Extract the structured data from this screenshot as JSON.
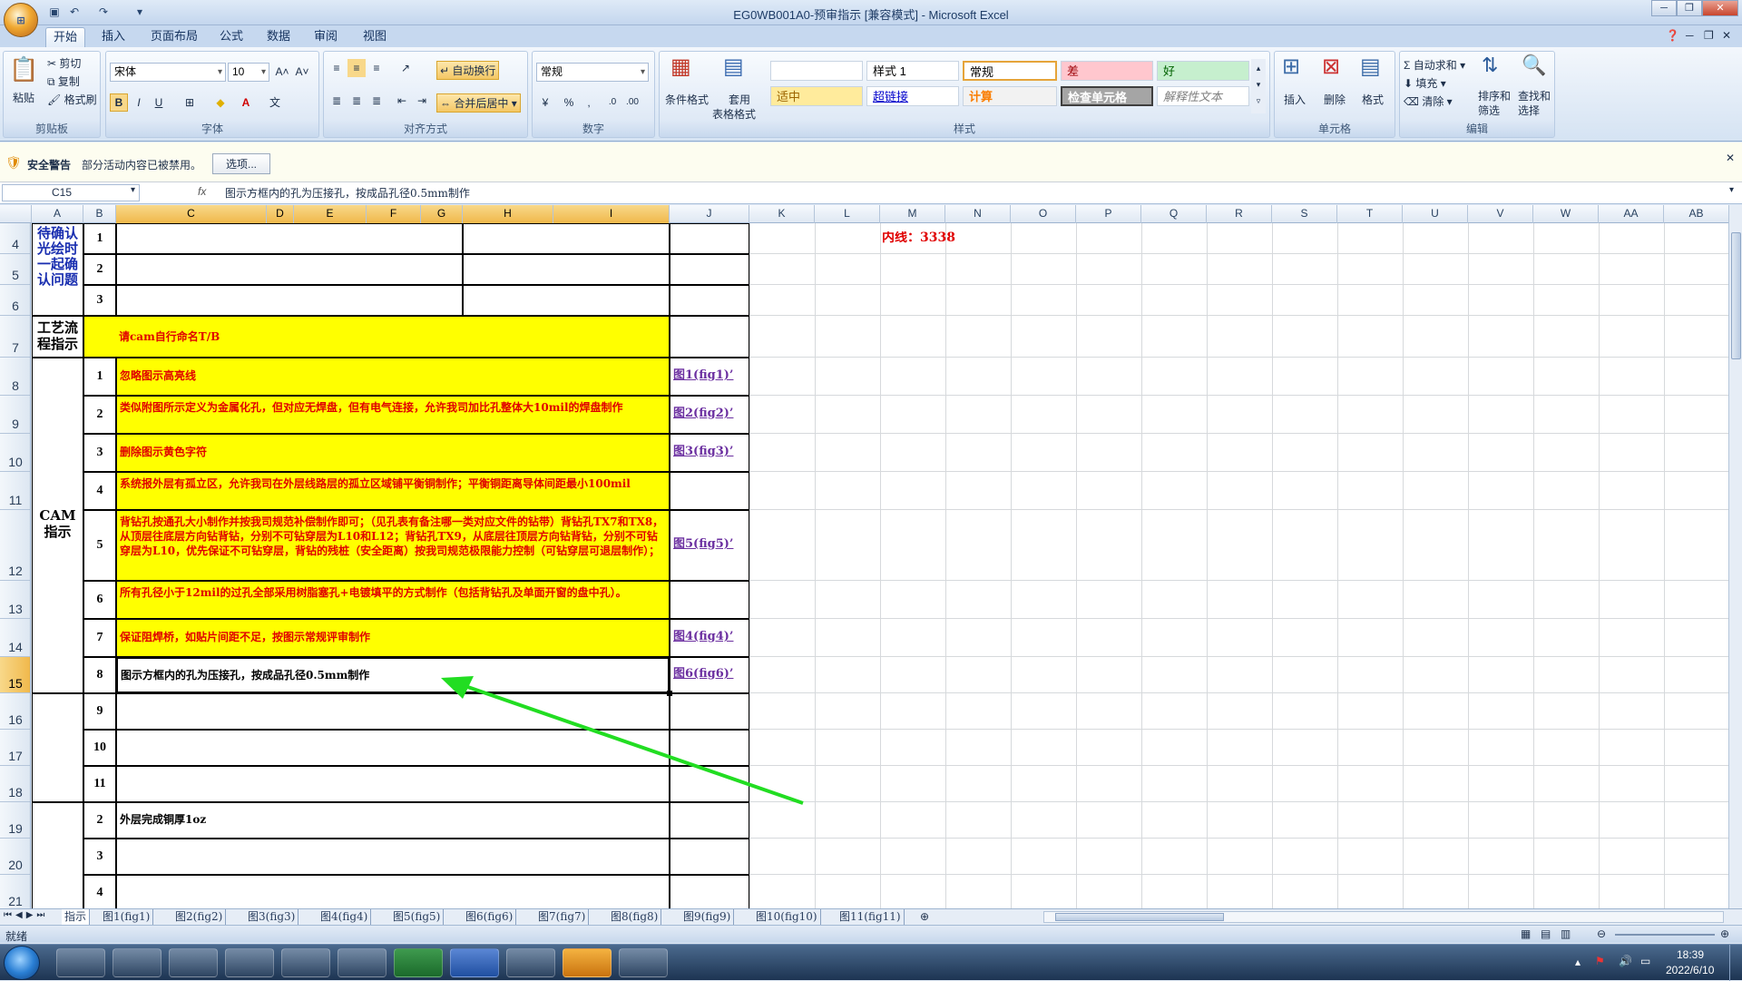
{
  "window": {
    "title": "EG0WB001A0-预审指示 [兼容模式] - Microsoft Excel"
  },
  "ribbon_tabs": [
    "开始",
    "插入",
    "页面布局",
    "公式",
    "数据",
    "审阅",
    "视图"
  ],
  "clipboard": {
    "paste": "粘贴",
    "cut": "剪切",
    "copy": "复制",
    "format_painter": "格式刷",
    "label": "剪贴板"
  },
  "font": {
    "name": "宋体",
    "size": "10",
    "label": "字体"
  },
  "alignment": {
    "wrap": "自动换行",
    "merge": "合并后居中",
    "label": "对齐方式"
  },
  "number": {
    "format": "常规",
    "label": "数字"
  },
  "styles": {
    "cond": "条件格式",
    "table": "套用",
    "table2": "表格格式",
    "label": "样式",
    "cells": [
      "",
      "样式 1",
      "常规",
      "差",
      "好",
      "适中",
      "超链接",
      "计算",
      "检查单元格",
      "解释性文本"
    ]
  },
  "cells_grp": {
    "insert": "插入",
    "delete": "删除",
    "format": "格式",
    "label": "单元格"
  },
  "edit_grp": {
    "autosum": "自动求和",
    "fill": "填充",
    "clear": "清除",
    "sort": "排序和",
    "sort2": "筛选",
    "find": "查找和",
    "find2": "选择",
    "label": "编辑"
  },
  "security": {
    "title": "安全警告",
    "msg": "部分活动内容已被禁用。",
    "options": "选项..."
  },
  "formula_bar": {
    "namebox": "C15",
    "fx": "fx",
    "content": "图示方框内的孔为压接孔，按成品孔径0.5mm制作"
  },
  "columns": [
    "A",
    "B",
    "C",
    "D",
    "E",
    "F",
    "G",
    "H",
    "I",
    "J",
    "K",
    "L",
    "M",
    "N",
    "O",
    "P",
    "Q",
    "R",
    "S",
    "T",
    "U",
    "V",
    "W",
    "AA",
    "AB"
  ],
  "rows": [
    "4",
    "5",
    "6",
    "7",
    "8",
    "9",
    "10",
    "11",
    "12",
    "13",
    "14",
    "15",
    "16",
    "17",
    "18",
    "19",
    "20",
    "21"
  ],
  "sheet": {
    "confirm_label": "待确认光绘时一起确认问题",
    "process_label": "工艺流程指示",
    "cam_label": "CAM指示",
    "process_text": "请cam自行命名T/B",
    "inner_layer": "内线：3338",
    "items": [
      {
        "n": "1",
        "text": "忽略图示高亮线",
        "link": "图1(fig1)’"
      },
      {
        "n": "2",
        "text": "类似附图所示定义为金属化孔，但对应无焊盘，但有电气连接，允许我司加比孔整体大10mil的焊盘制作",
        "link": "图2(fig2)’"
      },
      {
        "n": "3",
        "text": "删除图示黄色字符",
        "link": "图3(fig3)’"
      },
      {
        "n": "4",
        "text": "系统报外层有孤立区，允许我司在外层线路层的孤立区域铺平衡铜制作；平衡铜距离导体间距最小100mil",
        "link": ""
      },
      {
        "n": "5",
        "text": "背钻孔按通孔大小制作并按我司规范补偿制作即可；（见孔表有备注哪一类对应文件的钻带）背钻孔TX7和TX8，从顶层往底层方向钻背钻，分别不可钻穿层为L10和L12；背钻孔TX9，从底层往顶层方向钻背钻，分别不可钻穿层为L10，优先保证不可钻穿层，背钻的残桩（安全距离）按我司规范极限能力控制（可钻穿层可退层制作）；",
        "link": "图5(fig5)’"
      },
      {
        "n": "6",
        "text": "所有孔径小于12mil的过孔全部采用树脂塞孔+电镀填平的方式制作（包括背钻孔及单面开窗的盘中孔）。",
        "link": ""
      },
      {
        "n": "7",
        "text": "保证阻焊桥，如贴片间距不足，按图示常规评审制作",
        "link": "图4(fig4)’"
      },
      {
        "n": "8",
        "text": "图示方框内的孔为压接孔，按成品孔径0.5mm制作",
        "link": "图6(fig6)’"
      },
      {
        "n": "9",
        "text": "",
        "link": ""
      },
      {
        "n": "10",
        "text": "",
        "link": ""
      },
      {
        "n": "11",
        "text": "",
        "link": ""
      }
    ],
    "bottom": [
      {
        "n": "2",
        "text": "外层完成铜厚1oz"
      },
      {
        "n": "3",
        "text": ""
      },
      {
        "n": "4",
        "text": ""
      }
    ],
    "confirm_nums": [
      "1",
      "2",
      "3"
    ]
  },
  "sheet_tabs": [
    "指示",
    "图1(fig1)",
    "图2(fig2)",
    "图3(fig3)",
    "图4(fig4)",
    "图5(fig5)",
    "图6(fig6)",
    "图7(fig7)",
    "图8(fig8)",
    "图9(fig9)",
    "图10(fig10)",
    "图11(fig11)"
  ],
  "status": {
    "ready": "就绪"
  },
  "clock": {
    "time": "18:39",
    "date": "2022/6/10"
  }
}
